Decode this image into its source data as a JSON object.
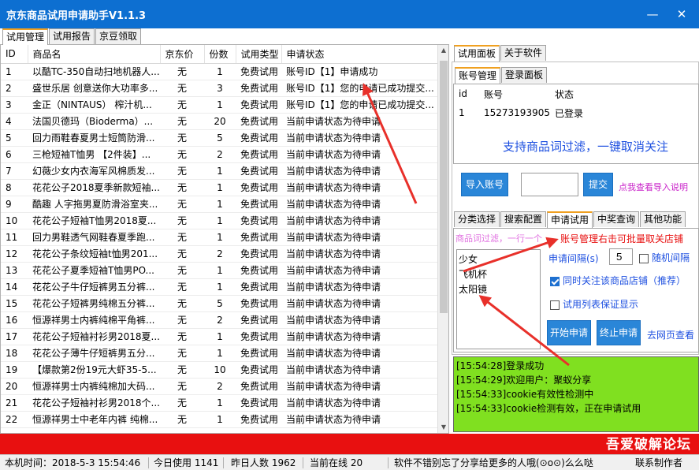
{
  "window": {
    "title": "京东商品试用申请助手V1.1.3",
    "minimize_glyph": "—",
    "close_glyph": "✕"
  },
  "main_tabs": [
    "试用管理",
    "试用报告",
    "京豆领取"
  ],
  "table": {
    "columns": [
      "ID",
      "商品名",
      "京东价",
      "份数",
      "试用类型",
      "申请状态"
    ],
    "rows": [
      [
        "1",
        "以酷TC-350自动扫地机器人...",
        "无",
        "1",
        "免费试用",
        "账号ID【1】申请成功"
      ],
      [
        "2",
        "盛世乐居 创意送你大功率多...",
        "无",
        "3",
        "免费试用",
        "账号ID【1】您的申请已成功提交..."
      ],
      [
        "3",
        "金正（NINTAUS） 榨汁机...",
        "无",
        "1",
        "免费试用",
        "账号ID【1】您的申请已成功提交..."
      ],
      [
        "4",
        "法国贝德玛（Bioderma）...",
        "无",
        "20",
        "免费试用",
        "当前申请状态为待申请"
      ],
      [
        "5",
        "回力雨鞋春夏男士短筒防滑...",
        "无",
        "5",
        "免费试用",
        "当前申请状态为待申请"
      ],
      [
        "6",
        "三枪短袖T恤男 【2件装】...",
        "无",
        "2",
        "免费试用",
        "当前申请状态为待申请"
      ],
      [
        "7",
        "幻薇少女内衣海军风棉质发...",
        "无",
        "1",
        "免费试用",
        "当前申请状态为待申请"
      ],
      [
        "8",
        "花花公子2018夏季新款短袖...",
        "无",
        "1",
        "免费试用",
        "当前申请状态为待申请"
      ],
      [
        "9",
        "酷趣 人字拖男夏防滑浴室夹...",
        "无",
        "1",
        "免费试用",
        "当前申请状态为待申请"
      ],
      [
        "10",
        "花花公子短袖T恤男2018夏...",
        "无",
        "1",
        "免费试用",
        "当前申请状态为待申请"
      ],
      [
        "11",
        "回力男鞋透气网鞋春夏季跑...",
        "无",
        "1",
        "免费试用",
        "当前申请状态为待申请"
      ],
      [
        "12",
        "花花公子条纹短袖t恤男201...",
        "无",
        "2",
        "免费试用",
        "当前申请状态为待申请"
      ],
      [
        "13",
        "花花公子夏季短袖T恤男PO...",
        "无",
        "1",
        "免费试用",
        "当前申请状态为待申请"
      ],
      [
        "14",
        "花花公子牛仔短裤男五分裤...",
        "无",
        "1",
        "免费试用",
        "当前申请状态为待申请"
      ],
      [
        "15",
        "花花公子短裤男纯棉五分裤...",
        "无",
        "5",
        "免费试用",
        "当前申请状态为待申请"
      ],
      [
        "16",
        "恒源祥男士内裤纯棉平角裤...",
        "无",
        "2",
        "免费试用",
        "当前申请状态为待申请"
      ],
      [
        "17",
        "花花公子短袖衬衫男2018夏...",
        "无",
        "1",
        "免费试用",
        "当前申请状态为待申请"
      ],
      [
        "18",
        "花花公子薄牛仔短裤男五分...",
        "无",
        "1",
        "免费试用",
        "当前申请状态为待申请"
      ],
      [
        "19",
        "【爆款第2份19元大虾35-5...",
        "无",
        "10",
        "免费试用",
        "当前申请状态为待申请"
      ],
      [
        "20",
        "恒源祥男士内裤纯棉加大码...",
        "无",
        "2",
        "免费试用",
        "当前申请状态为待申请"
      ],
      [
        "21",
        "花花公子短袖衬衫男2018个...",
        "无",
        "1",
        "免费试用",
        "当前申请状态为待申请"
      ],
      [
        "22",
        "恒源祥男士中老年内裤 纯棉...",
        "无",
        "1",
        "免费试用",
        "当前申请状态为待申请"
      ]
    ]
  },
  "right_tabs": [
    "试用面板",
    "关于软件"
  ],
  "account_tabs": [
    "账号管理",
    "登录面板"
  ],
  "accounts": {
    "columns": [
      "id",
      "账号",
      "状态"
    ],
    "rows": [
      [
        "1",
        "15273193905",
        "已登录"
      ]
    ]
  },
  "annotation_top": "支持商品词过滤，一键取消关注",
  "import": {
    "button": "导入账号",
    "input_value": "",
    "submit": "提交",
    "link": "点我查看导入说明"
  },
  "func_tabs": [
    "分类选择",
    "搜索配置",
    "申请试用",
    "中奖查询",
    "其他功能"
  ],
  "filter": {
    "placeholder": "商品词过滤，一行一个",
    "words": [
      "少女",
      "飞机杯",
      "太阳镜"
    ]
  },
  "annotation_mid": "账号管理右击可批量取关店铺",
  "interval": {
    "label": "申请间隔(s)",
    "value": "5",
    "random": "随机间隔"
  },
  "follow_shop": "同时关注该商品店铺（推荐）",
  "keep_list": "试用列表保证显示",
  "actions": {
    "start": "开始申请",
    "stop": "终止申请",
    "web": "去网页查看"
  },
  "log": [
    "[15:54:28]登录成功",
    "[15:54:29]欢迎用户：聚蚁分享",
    "[15:54:33]cookie有效性检测中",
    "[15:54:33]cookie检测有效，正在申请试用"
  ],
  "watermark": "吾爱破解论坛",
  "status": {
    "time": "本机时间：2018-5-3 15:54:46",
    "today": "今日使用 1141",
    "yesterday": "昨日人数 1962",
    "online": "当前在线 20",
    "message": "软件不错别忘了分享给更多的人哦(⊙o⊙)么么哒",
    "contact": "联系制作者"
  },
  "colors": {
    "titlebar": "#0d6fd1",
    "accent_button": "#2a86d8",
    "log_bg": "#80e020",
    "red_bar": "#e81010",
    "annotation_arrow": "#e8302a",
    "annotation_text": "#1e50e0"
  }
}
